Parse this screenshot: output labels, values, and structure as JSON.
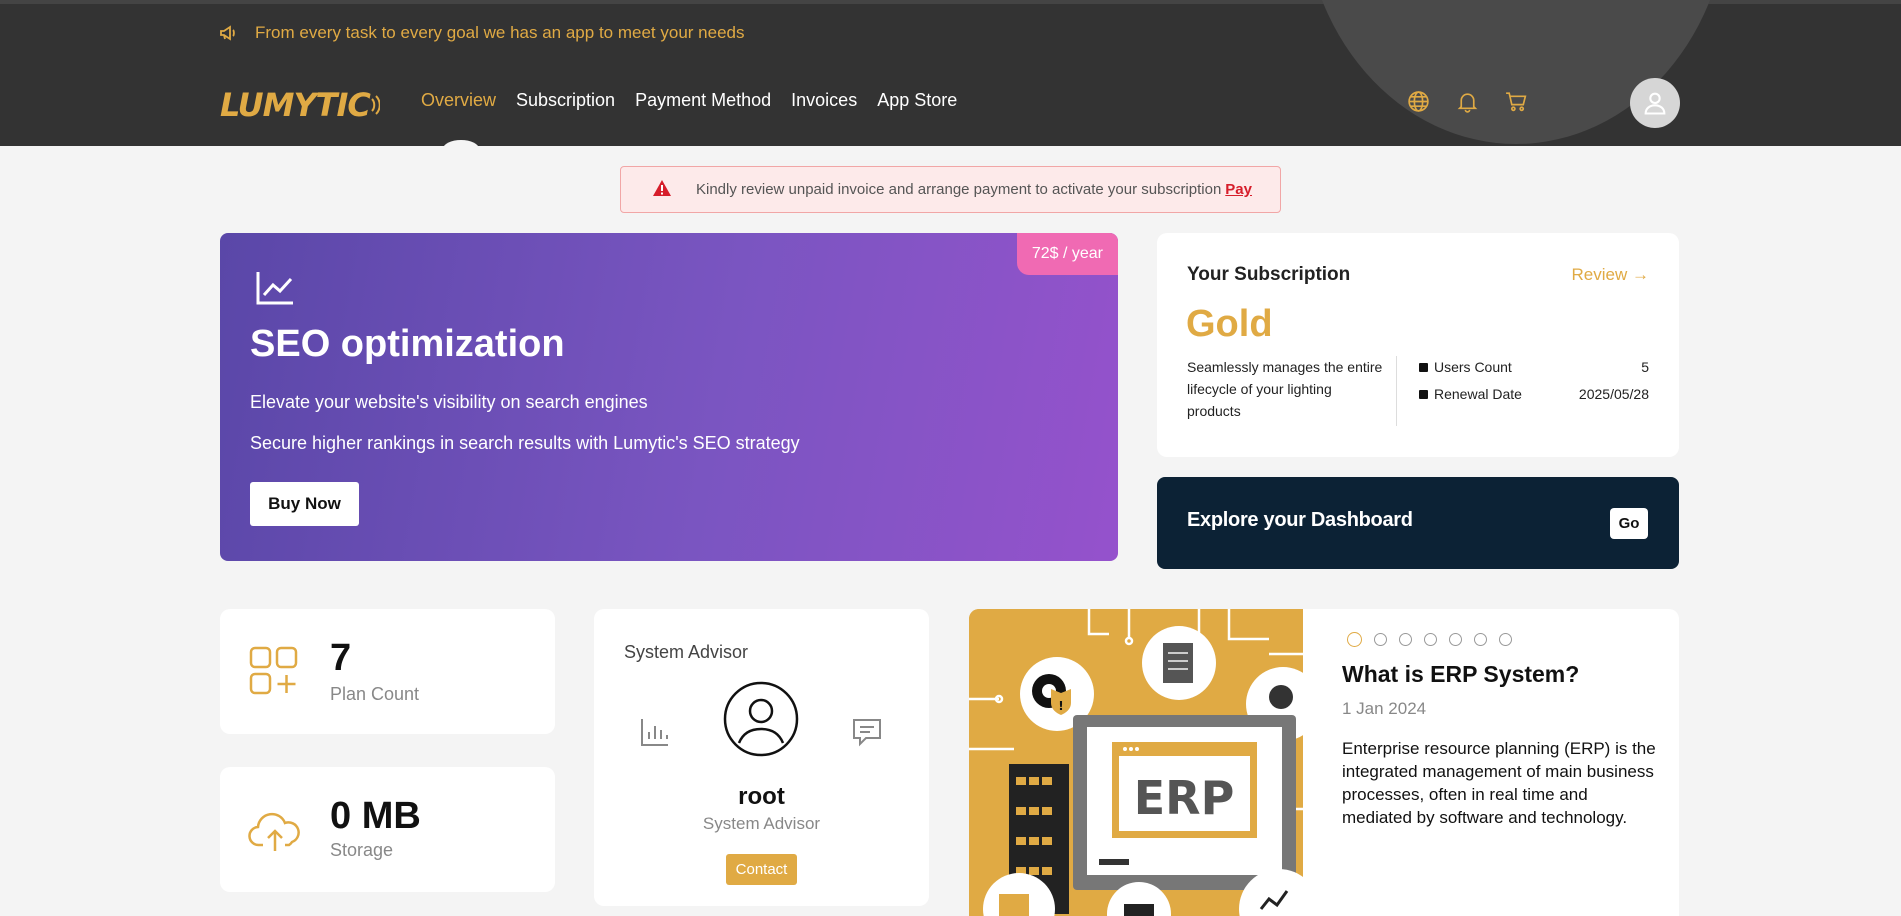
{
  "header": {
    "announcement": "From every task to every goal we has an app to meet your needs",
    "logo_text": "LUMYTIC",
    "nav": [
      {
        "label": "Overview",
        "active": true
      },
      {
        "label": "Subscription"
      },
      {
        "label": "Payment Method"
      },
      {
        "label": "Invoices"
      },
      {
        "label": "App Store"
      }
    ],
    "icons": [
      "globe-icon",
      "bell-icon",
      "cart-icon",
      "user-avatar-icon"
    ]
  },
  "alert": {
    "message": "Kindly review unpaid invoice and arrange payment to activate your subscription",
    "link": "Pay",
    "icon": "warning-icon",
    "color": "#d61e2b"
  },
  "hero": {
    "price_badge": "72$ / year",
    "icon": "line-chart-icon",
    "title": "SEO optimization",
    "line1": "Elevate your website's visibility on search engines",
    "line2": "Secure higher rankings in search results with Lumytic's SEO strategy",
    "button": "Buy Now"
  },
  "subscription": {
    "title": "Your Subscription",
    "review": "Review →",
    "plan": "Gold",
    "description": "Seamlessly manages the entire lifecycle of your lighting products",
    "rows": [
      {
        "label": "Users Count",
        "value": "5"
      },
      {
        "label": "Renewal Date",
        "value": "2025/05/28"
      }
    ]
  },
  "explore": {
    "title": "Explore your Dashboard",
    "button": "Go"
  },
  "stats": [
    {
      "value": "7",
      "label": "Plan Count",
      "icon": "apps-add-icon"
    },
    {
      "value": "0 MB",
      "label": "Storage",
      "icon": "cloud-upload-icon"
    }
  ],
  "advisor": {
    "title": "System Advisor",
    "name": "root",
    "role": "System Advisor",
    "button": "Contact"
  },
  "article": {
    "image_text": "ERP",
    "title": "What is ERP System?",
    "date": "1 Jan 2024",
    "body": "Enterprise resource planning (ERP) is the integrated management of main business processes, often in real time and mediated by software and technology.",
    "slides": 7,
    "active_slide": 1
  },
  "colors": {
    "accent": "#e0aa44",
    "header_bg": "#333333",
    "explore_bg": "#0c2235",
    "price_badge": "#f06ab3"
  }
}
